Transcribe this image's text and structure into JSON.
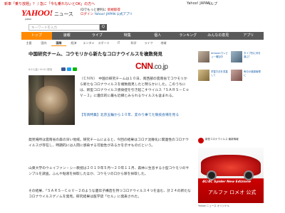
{
  "topbar": {
    "promo": "新車「乗り放題」？ / 急に「今も乗れないとOK」の方へ",
    "jp": "Yahoo! JAPAN",
    "help": "ヘルプ"
  },
  "header": {
    "logo": "YAHOO!",
    "logo_sub": "JAPAN",
    "news": "ニュース",
    "account_line1": "IDでもっと便利に",
    "account_line1b": "新規取得",
    "account_line2": "ログイン",
    "account_line2b": "Yahoo! JAPAN 公式アプリ"
  },
  "search": {
    "placeholder": "キーワードを入力",
    "button": "Q"
  },
  "nav": {
    "tabs": [
      "トップ",
      "速報",
      "ライブ",
      "特集",
      "個人",
      "ランキング",
      "みんなの意見",
      "アプリ"
    ]
  },
  "subnav": {
    "tabs": [
      "主要",
      "国内",
      "国際",
      "経済",
      "エンタメ",
      "スポーツ",
      "IT",
      "科学",
      "ライフ",
      "地域"
    ]
  },
  "article": {
    "headline": "中国研究チーム、コウモリから新たなコロナウイルスを複数発見",
    "meta": "6/11(金) 19:01 配信",
    "source": "CNN",
    "source_suffix": ".co.jp",
    "lead": "（ＣＮＮ）　中国の研究チームは１０日、南西部の雲南省でコウモリから新たなコロナウイルスを複数発見したと明らかにした。このうちには、新型コロナウイルス感染症を引き起こすウイルス「ＳＡＲＳ－ＣｏＶ－２」に遺伝的に最も近縁とみられるウイルスも含まれる。",
    "related_label": "【写真特集】",
    "related_link": "北京五輪から１０年、変わり果てた競技会場を見る",
    "para1": "発見場所は雲南省の森の深い地域。研究チームによると、今回の結果はコロナ沈静化に関連性のコロナウイルスが存在し、時期的には人間に感染する可能性があるかを示すものだという。",
    "para2": "山東大学のウェイファン・シー教授は２０１９年５月～２０年１１月、森林に生息する小型コウモリのサンプルを調査。ふんや粘液を採取したほか、コウモリの口から尿を採取した。",
    "para3": "その結果、「ＳＡＲＳ－ＣｏＶ－２のような遺伝子構造を持つコロナウイルス４つを含む、計２４の新たなコロナウイルスゲノムを発見。研究結果は医学誌「セル」に発表された。"
  },
  "sidebar": {
    "ads": [
      "Amazonでレビュー増加中",
      "タイプ別に何を選ぶ？",
      "学習方法を見直して",
      "毎日の健康管理に"
    ],
    "red_note": "新型コロナウイルス 最新情報",
    "car_tag": "4C/4C Spider New Edizione",
    "car_brand": "アルファ ロメオ 公式",
    "car_foot": "Yahoo!ニュース オリジナル",
    "under_ad": "Yahoo!ニュース"
  }
}
